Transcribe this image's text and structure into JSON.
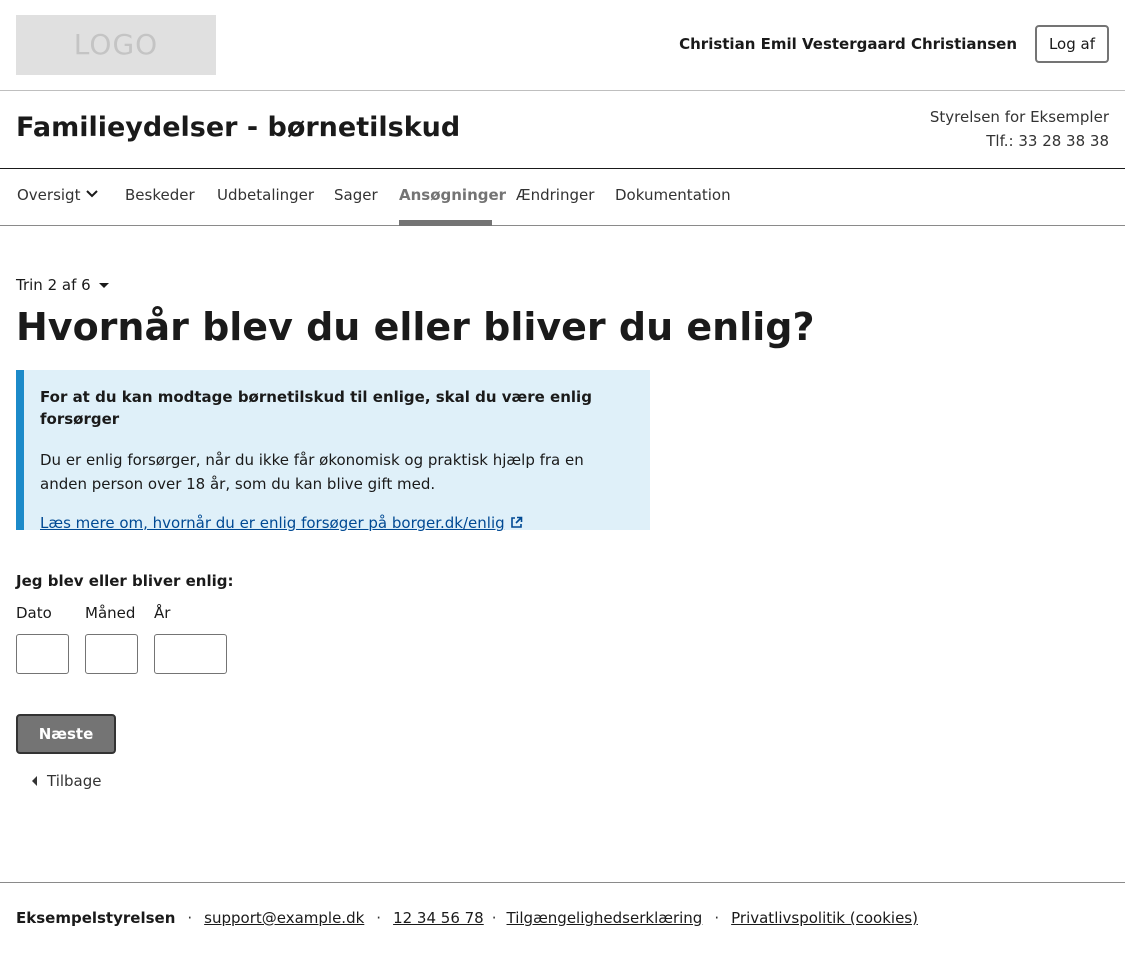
{
  "header": {
    "logo_text": "LOGO",
    "user_name": "Christian Emil Vestergaard Christiansen",
    "logout_label": "Log af"
  },
  "service": {
    "title": "Familieydelser - børnetilskud",
    "authority": "Styrelsen for Eksempler",
    "phone": "Tlf.: 33 28 38 38"
  },
  "nav": {
    "items": [
      {
        "label": "Oversigt",
        "has_dropdown": true,
        "icon": "chevron-down-icon"
      },
      {
        "label": "Beskeder"
      },
      {
        "label": "Udbetalinger"
      },
      {
        "label": "Sager"
      },
      {
        "label": "Ansøgninger",
        "active": true
      },
      {
        "label": "Ændringer"
      },
      {
        "label": "Dokumentation"
      }
    ]
  },
  "main": {
    "step_label": "Trin 2 af 6",
    "heading": "Hvornår blev du eller bliver du enlig?",
    "info": {
      "title": "For at du kan modtage børnetilskud til enlige, skal du være enlig forsørger",
      "text": "Du er enlig forsørger, når du ikke får økonomisk og praktisk hjælp fra en anden person over 18 år, som du kan blive gift med.",
      "link_text": "Læs mere om, hvornår du er enlig forsøger på borger.dk/enlig",
      "link_icon": "external-link-icon"
    },
    "date_field": {
      "label": "Jeg blev eller bliver enlig:",
      "day_label": "Dato",
      "month_label": "Måned",
      "year_label": "År",
      "day_value": "",
      "month_value": "",
      "year_value": ""
    },
    "next_label": "Næste",
    "back_label": "Tilbage"
  },
  "footer": {
    "org": "Eksempelstyrelsen",
    "email": "support@example.dk",
    "phone": "12 34 56 78",
    "accessibility": "Tilgængelighedserklæring",
    "privacy": "Privatlivspolitik (cookies)",
    "separator": "·"
  },
  "colors": {
    "info_background": "#dff0f9",
    "info_border": "#1c8ac9",
    "link": "#004993",
    "active_nav": "#747474",
    "primary_button": "#747474"
  }
}
